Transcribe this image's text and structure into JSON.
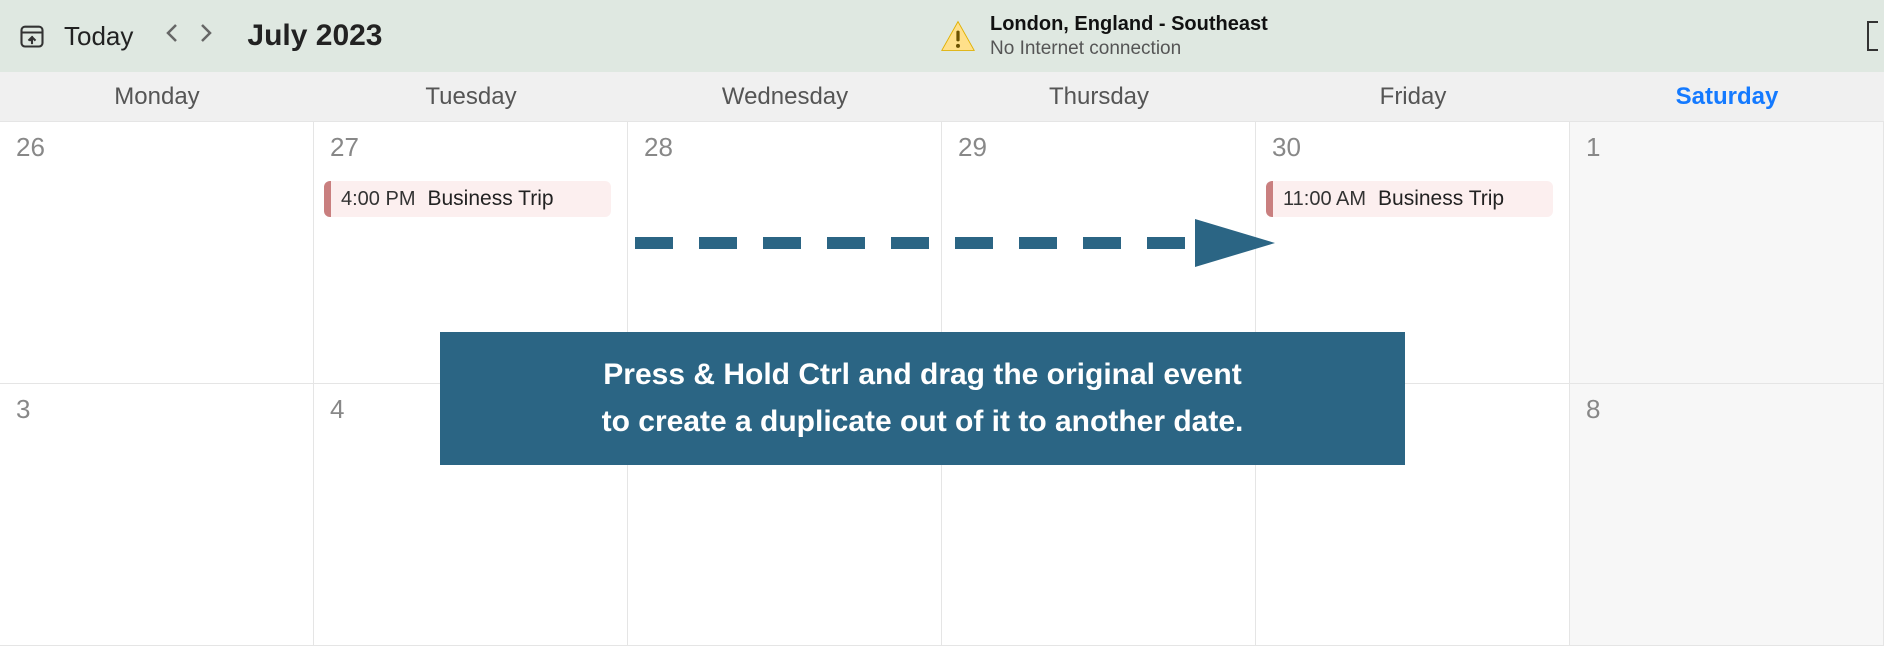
{
  "toolbar": {
    "today_label": "Today",
    "month_title": "July 2023"
  },
  "status": {
    "location": "London, England - Southeast",
    "network": "No Internet connection"
  },
  "weekdays": [
    "Monday",
    "Tuesday",
    "Wednesday",
    "Thursday",
    "Friday",
    "Saturday"
  ],
  "today_weekday_index": 5,
  "days_row1": [
    "26",
    "27",
    "28",
    "29",
    "30",
    "1"
  ],
  "days_row2": [
    "3",
    "4",
    "",
    "",
    "",
    "8"
  ],
  "events": {
    "source": {
      "time": "4:00 PM",
      "title": "Business Trip"
    },
    "target": {
      "time": "11:00 AM",
      "title": "Business Trip"
    }
  },
  "tip_line1": "Press & Hold Ctrl and drag the original event",
  "tip_line2": "to create a duplicate out of it to another date."
}
